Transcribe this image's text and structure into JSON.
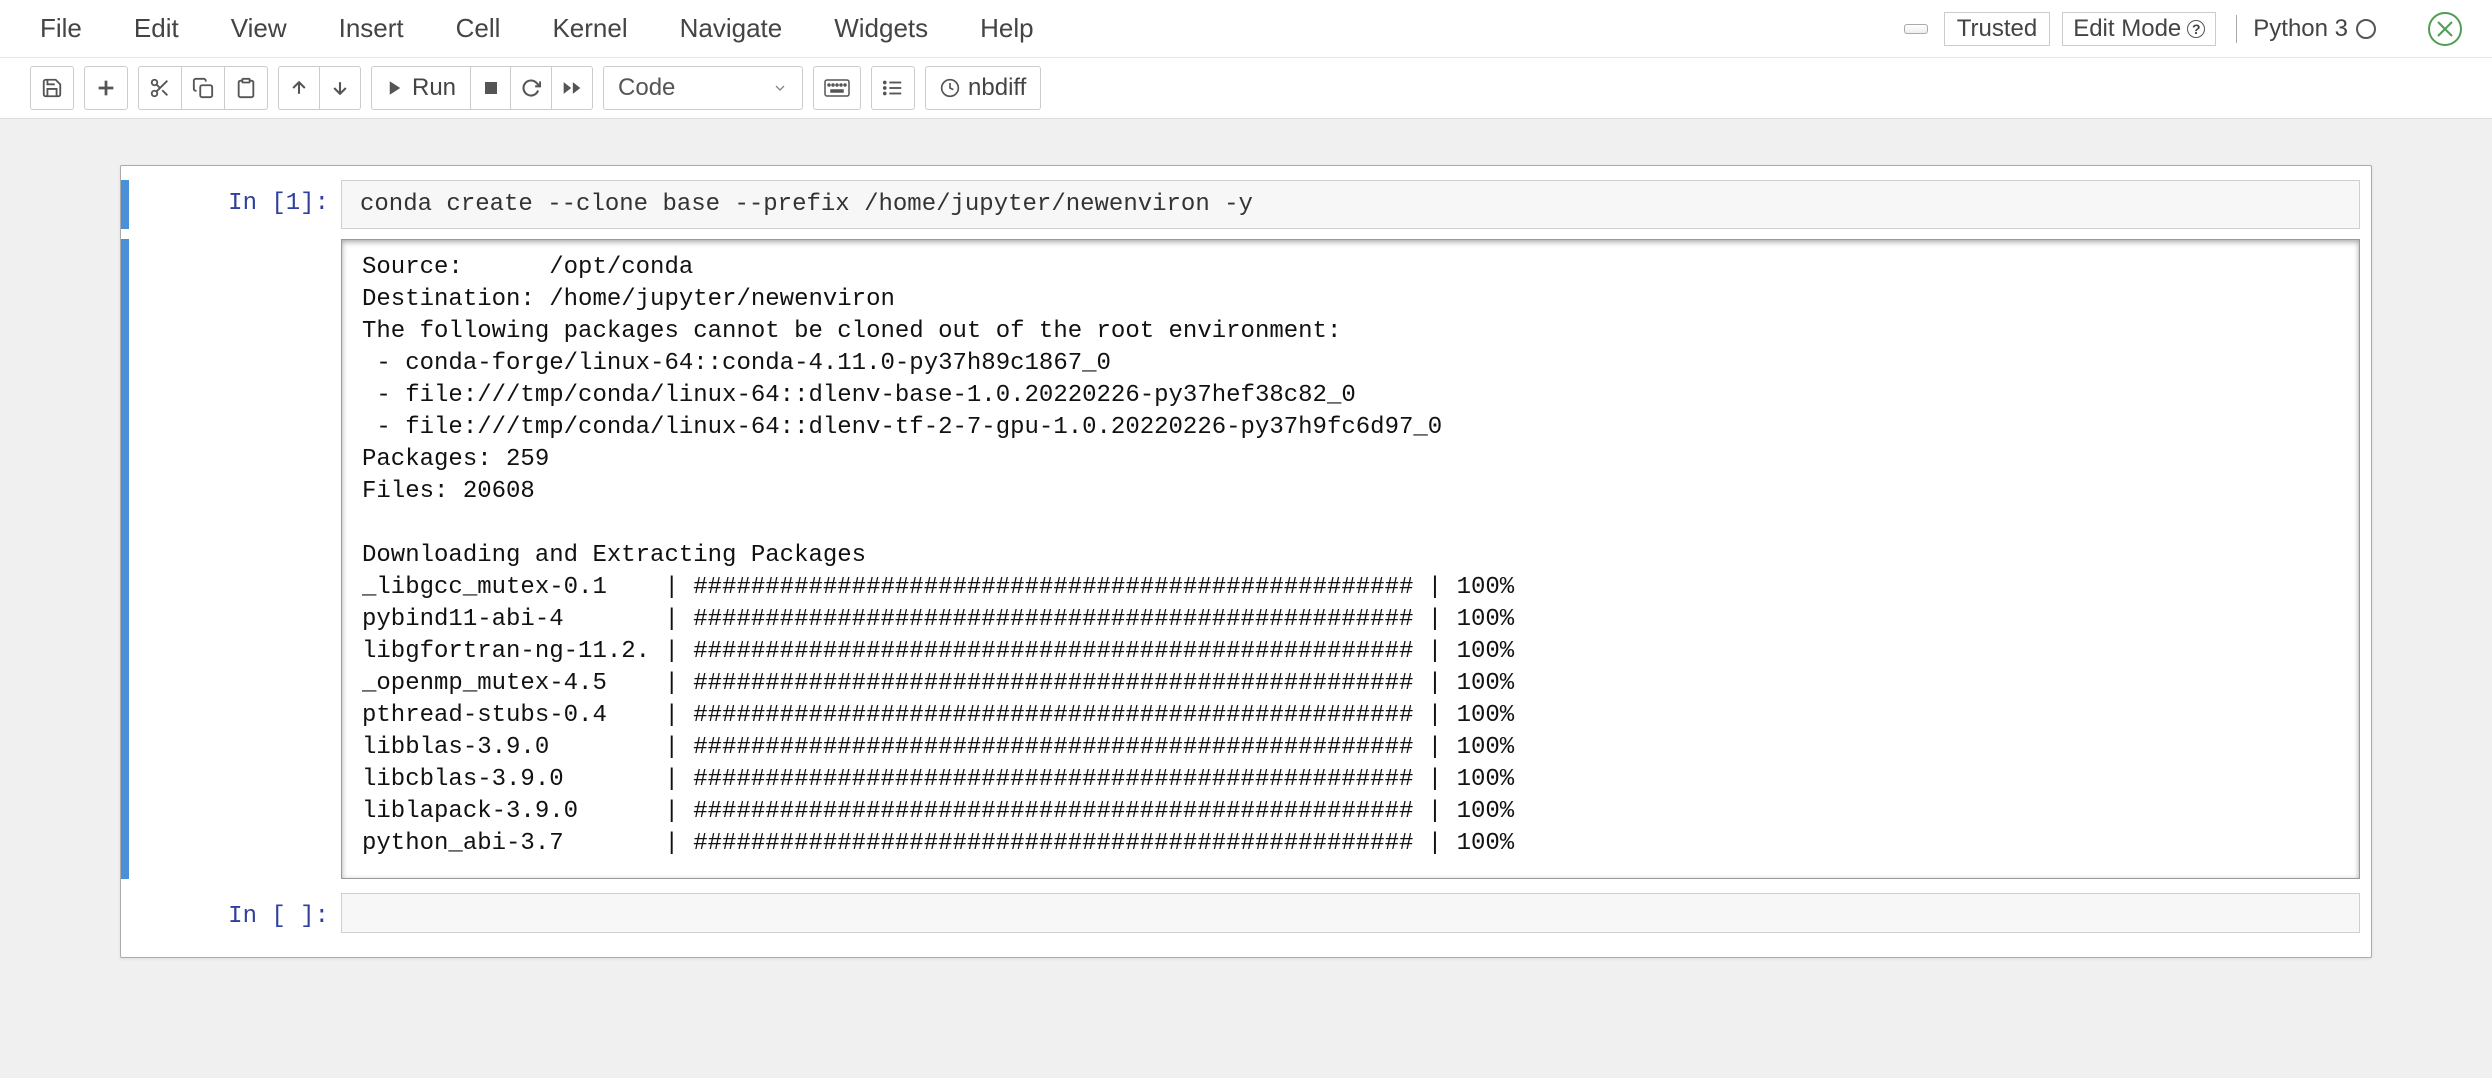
{
  "menu": {
    "items": [
      "File",
      "Edit",
      "View",
      "Insert",
      "Cell",
      "Kernel",
      "Navigate",
      "Widgets",
      "Help"
    ]
  },
  "header": {
    "trusted": "Trusted",
    "edit_mode": "Edit Mode",
    "kernel_name": "Python 3"
  },
  "toolbar": {
    "run_label": "Run",
    "celltype": "Code",
    "nbdiff": "nbdiff"
  },
  "cells": [
    {
      "prompt": "In [1]:",
      "source": "conda create --clone base --prefix /home/jupyter/newenviron -y",
      "output": "Source:      /opt/conda\nDestination: /home/jupyter/newenviron\nThe following packages cannot be cloned out of the root environment:\n - conda-forge/linux-64::conda-4.11.0-py37h89c1867_0\n - file:///tmp/conda/linux-64::dlenv-base-1.0.20220226-py37hef38c82_0\n - file:///tmp/conda/linux-64::dlenv-tf-2-7-gpu-1.0.20220226-py37h9fc6d97_0\nPackages: 259\nFiles: 20608\n\nDownloading and Extracting Packages\n_libgcc_mutex-0.1    | ################################################## | 100%\npybind11-abi-4       | ################################################## | 100%\nlibgfortran-ng-11.2. | ################################################## | 100%\n_openmp_mutex-4.5    | ################################################## | 100%\npthread-stubs-0.4    | ################################################## | 100%\nlibblas-3.9.0        | ################################################## | 100%\nlibcblas-3.9.0       | ################################################## | 100%\nliblapack-3.9.0      | ################################################## | 100%\npython_abi-3.7       | ################################################## | 100%"
    },
    {
      "prompt": "In [ ]:",
      "source": "",
      "output": ""
    }
  ]
}
